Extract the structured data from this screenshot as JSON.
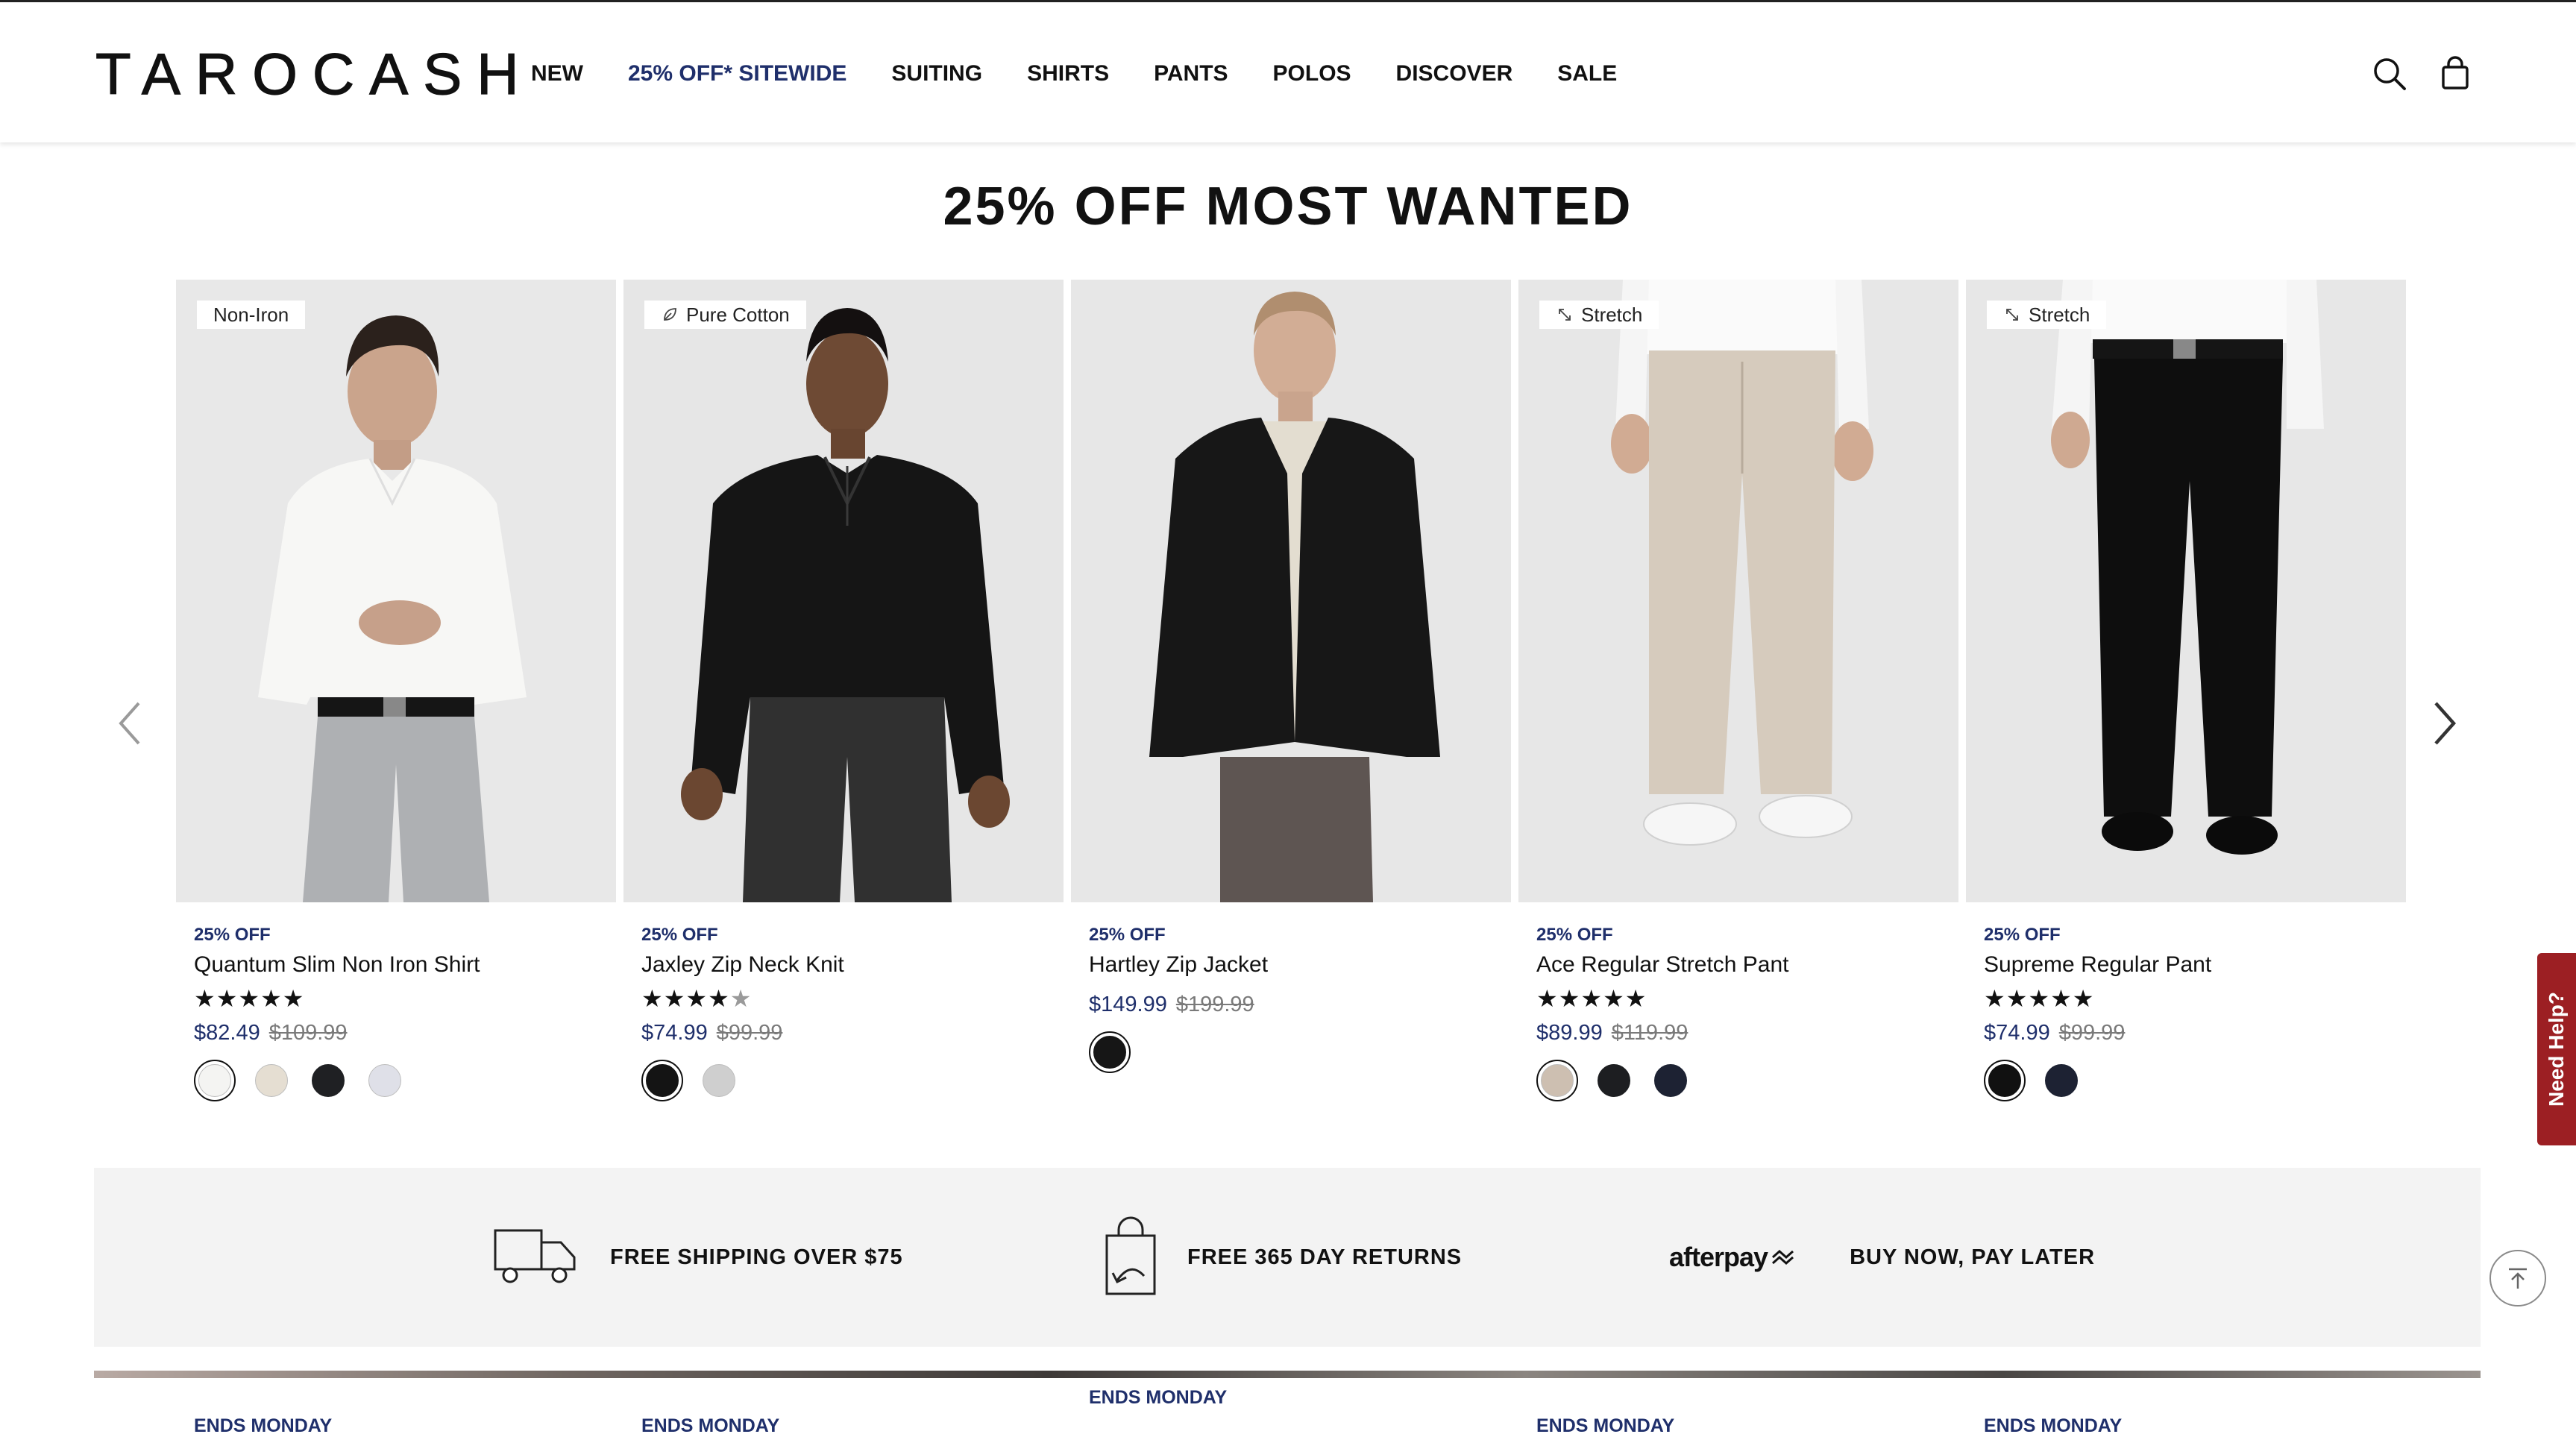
{
  "header": {
    "logo": "TAROCASH",
    "nav": [
      {
        "label": "NEW",
        "accent": false
      },
      {
        "label": "25% OFF* SITEWIDE",
        "accent": true
      },
      {
        "label": "SUITING",
        "accent": false
      },
      {
        "label": "SHIRTS",
        "accent": false
      },
      {
        "label": "PANTS",
        "accent": false
      },
      {
        "label": "POLOS",
        "accent": false
      },
      {
        "label": "DISCOVER",
        "accent": false
      },
      {
        "label": "SALE",
        "accent": false
      }
    ],
    "icons": [
      "search-icon",
      "shopping-bag-icon"
    ]
  },
  "section": {
    "title": "25% OFF MOST WANTED"
  },
  "carousel": {
    "icons": [
      "chevron-left-icon",
      "chevron-right-icon"
    ]
  },
  "products": [
    {
      "badge": "Non-Iron",
      "badge_icon": "",
      "promo": "25% OFF",
      "name": "Quantum Slim Non Iron Shirt",
      "rating": 5,
      "price": "$82.49",
      "was": "$109.99",
      "swatches": [
        "#f4f4f2",
        "#e5ded2",
        "#1f2023",
        "#dfe0e8"
      ],
      "ends": "ENDS MONDAY"
    },
    {
      "badge": "Pure Cotton",
      "badge_icon": "leaf-icon",
      "promo": "25% OFF",
      "name": "Jaxley Zip Neck Knit",
      "rating": 4,
      "price": "$74.99",
      "was": "$99.99",
      "swatches": [
        "#141414",
        "#cfcfcf"
      ],
      "ends": "ENDS MONDAY"
    },
    {
      "badge": "",
      "badge_icon": "",
      "promo": "25% OFF",
      "name": "Hartley Zip Jacket",
      "rating": 0,
      "price": "$149.99",
      "was": "$199.99",
      "swatches": [
        "#161616"
      ],
      "ends": "ENDS MONDAY"
    },
    {
      "badge": "Stretch",
      "badge_icon": "stretch-arrows-icon",
      "promo": "25% OFF",
      "name": "Ace Regular Stretch Pant",
      "rating": 5,
      "price": "$89.99",
      "was": "$119.99",
      "swatches": [
        "#cdbfb1",
        "#1d1e21",
        "#1d2233"
      ],
      "ends": "ENDS MONDAY"
    },
    {
      "badge": "Stretch",
      "badge_icon": "stretch-arrows-icon",
      "promo": "25% OFF",
      "name": "Supreme Regular Pant",
      "rating": 5,
      "price": "$74.99",
      "was": "$99.99",
      "swatches": [
        "#111111",
        "#1d2233"
      ],
      "ends": "ENDS MONDAY"
    }
  ],
  "services": [
    {
      "icon": "delivery-truck-icon",
      "text": "FREE SHIPPING OVER $75"
    },
    {
      "icon": "returns-bag-icon",
      "text": "FREE 365 DAY RETURNS"
    },
    {
      "icon": "afterpay-logo",
      "logo": "afterpay",
      "text": "BUY NOW, PAY LATER"
    }
  ],
  "floating": {
    "need_help": "Need Help?"
  },
  "colors": {
    "accent": "#1f2f6b",
    "need_help": "#9c1f23",
    "image_bg": "#e7e7e7"
  }
}
